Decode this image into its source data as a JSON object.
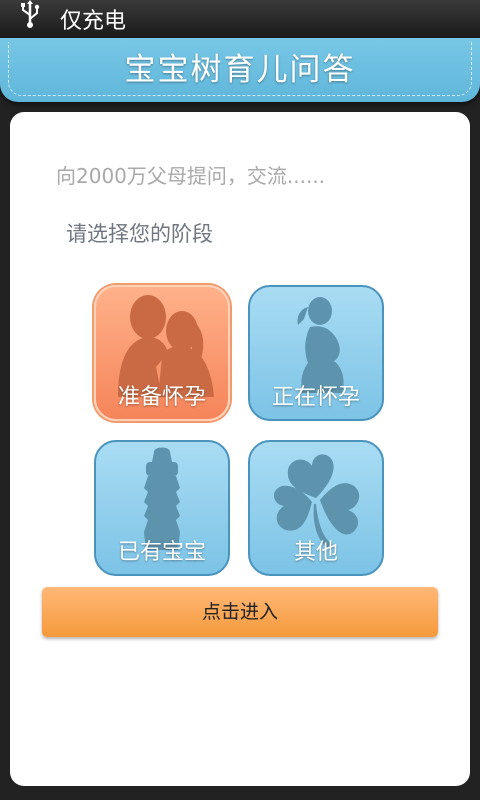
{
  "status_bar": {
    "usb_icon": "usb-icon",
    "text": "仅充电"
  },
  "app_bar": {
    "title": "宝宝树育儿问答",
    "color": "#6cbfe0"
  },
  "main": {
    "search_hint": "向2000万父母提问，交流......",
    "stage_prompt": "请选择您的阶段",
    "stages": [
      {
        "label": "准备怀孕",
        "icon": "couple-icon",
        "selected": true,
        "color": "#f7875c"
      },
      {
        "label": "正在怀孕",
        "icon": "pregnant-woman-icon",
        "selected": false,
        "color": "#8ccdea"
      },
      {
        "label": "已有宝宝",
        "icon": "baby-bottle-icon",
        "selected": false,
        "color": "#8ccdea"
      },
      {
        "label": "其他",
        "icon": "clover-icon",
        "selected": false,
        "color": "#8ccdea"
      }
    ],
    "enter_button": "点击进入",
    "enter_button_color": "#f7a24a"
  }
}
